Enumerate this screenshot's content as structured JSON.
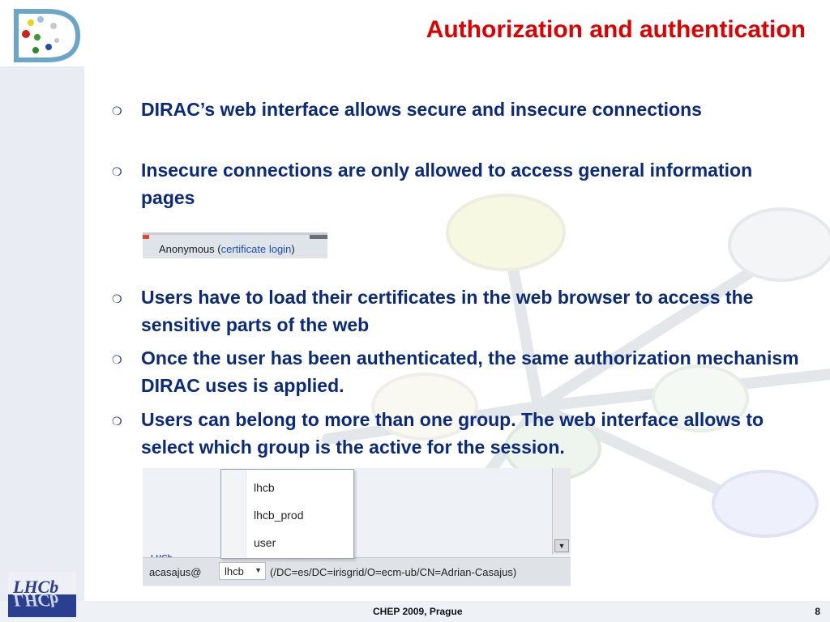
{
  "slide": {
    "title": "Authorization and authentication",
    "bullets": [
      "DIRAC’s web interface allows secure and insecure connections",
      "Insecure connections are only allowed to access general information pages",
      "Users have to load their certificates in the web browser to access the sensitive parts of the web",
      "Once the user has been authenticated, the same authorization mechanism DIRAC uses is applied.",
      "Users can belong to more than one group. The web interface allows to select which group is the active for the session."
    ],
    "bullet_glyph": "❍"
  },
  "anon_bar": {
    "prefix": "Anonymous (",
    "link": "certificate login",
    "suffix": ")"
  },
  "group_shot": {
    "tab_label": "LHCb",
    "user": "acasajus@",
    "selected_group": "lhcb",
    "dn": "(/DC=es/DC=irisgrid/O=ecm-ub/CN=Adrian-Casajus)",
    "menu_items": [
      "lhcb",
      "lhcb_prod",
      "user"
    ],
    "arrow_glyph": "▼"
  },
  "logos": {
    "top_left": "dirac-logo",
    "bottom_left_text": "LHCb"
  },
  "footer": {
    "center": "CHEP 2009, Prague",
    "page": "8"
  },
  "colors": {
    "title": "#e00000",
    "bullet_text": "#0a2a80",
    "link": "#1d4fb0"
  }
}
